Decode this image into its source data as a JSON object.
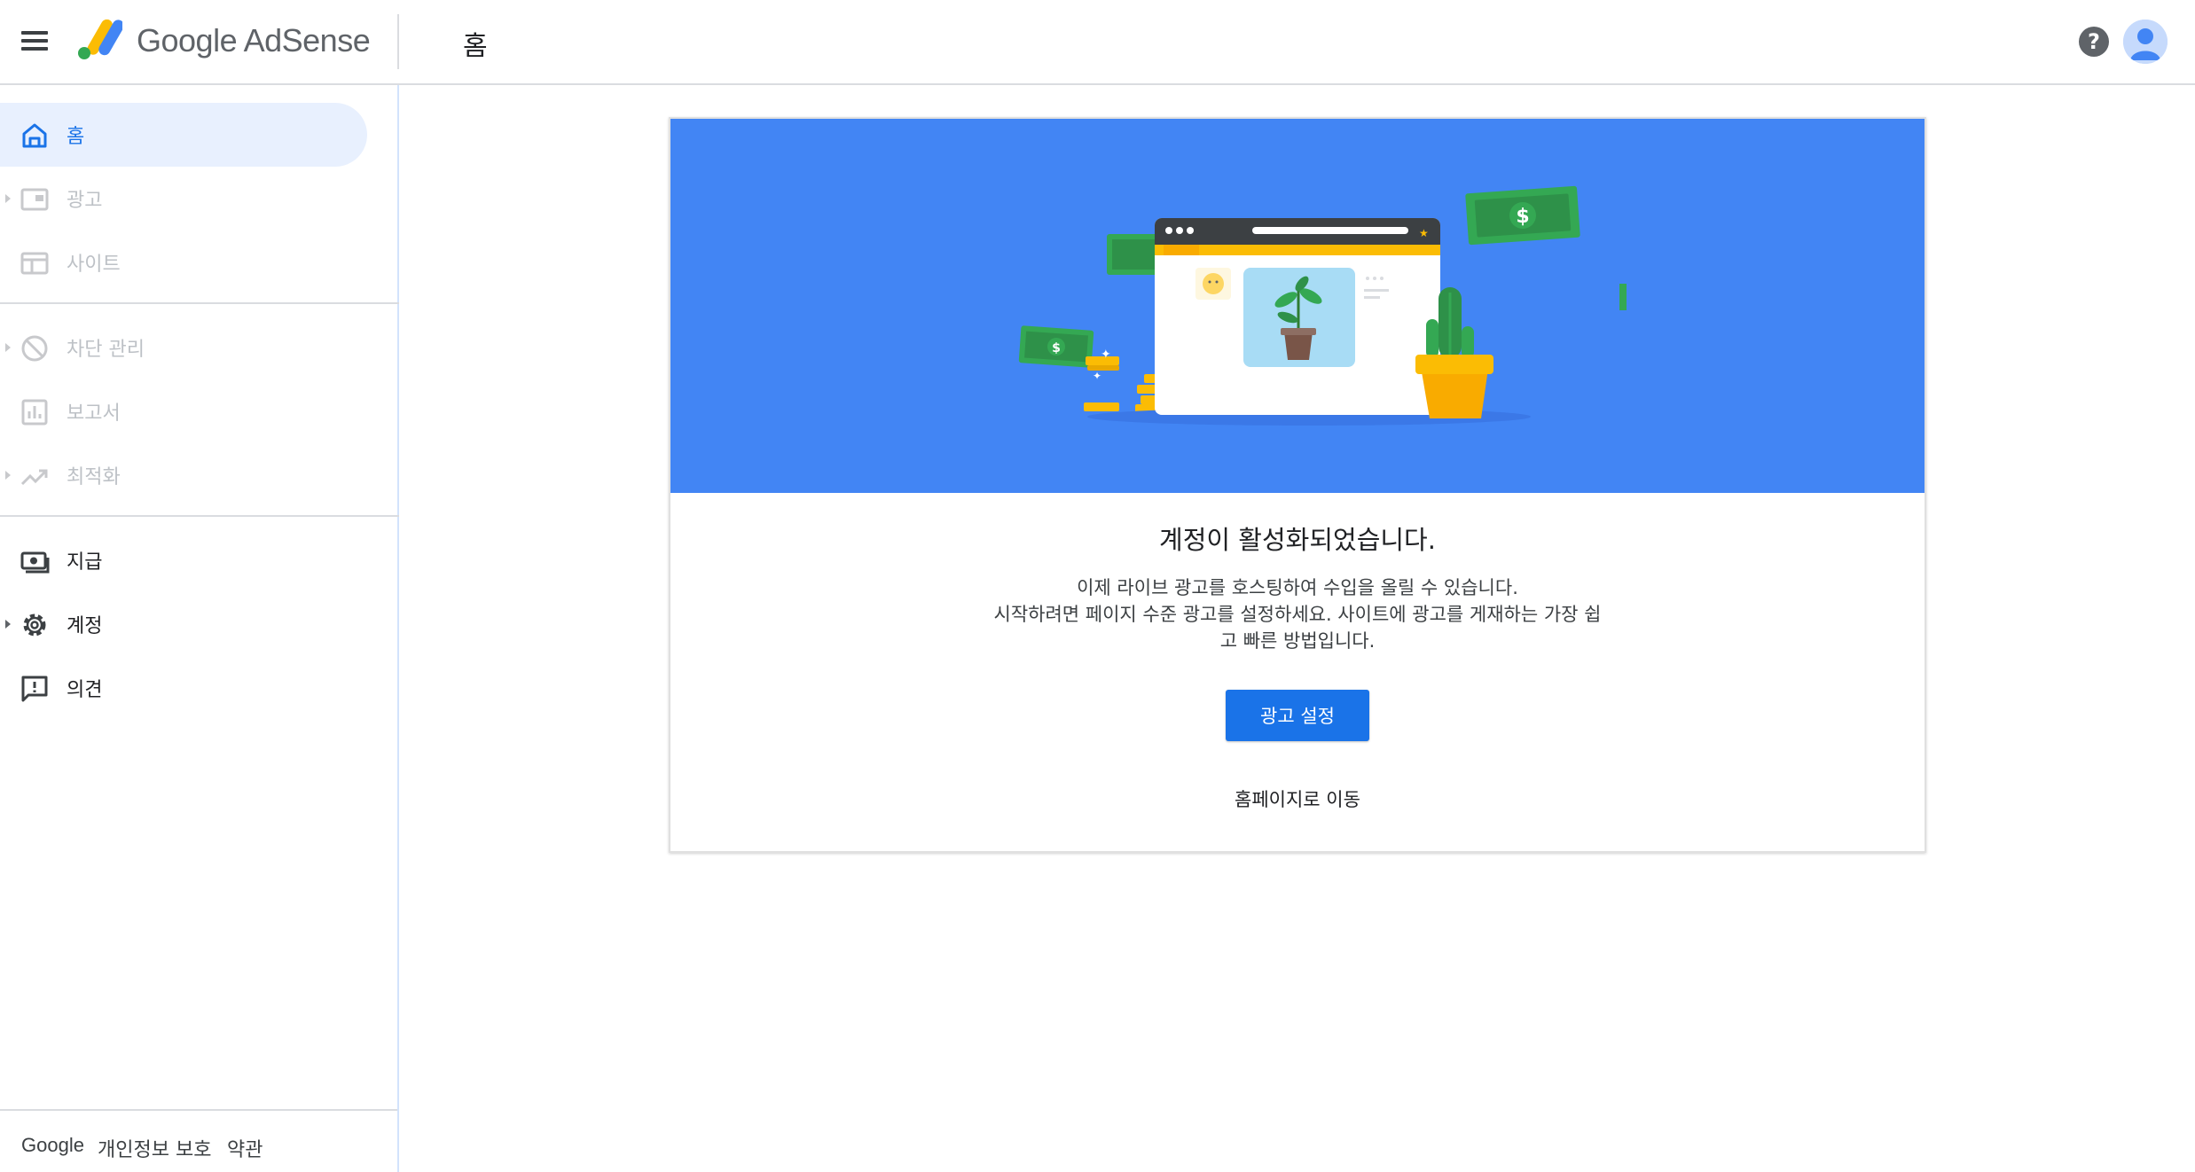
{
  "header": {
    "brand": "Google AdSense",
    "page_title": "홈",
    "help_glyph": "?"
  },
  "sidebar": {
    "items": [
      {
        "label": "홈",
        "icon": "home-icon",
        "state": "active",
        "expandable": false
      },
      {
        "label": "광고",
        "icon": "ads-icon",
        "state": "disabled",
        "expandable": true
      },
      {
        "label": "사이트",
        "icon": "sites-icon",
        "state": "disabled",
        "expandable": false
      },
      {
        "label": "차단 관리",
        "icon": "block-icon",
        "state": "disabled",
        "expandable": true
      },
      {
        "label": "보고서",
        "icon": "reports-icon",
        "state": "disabled",
        "expandable": false
      },
      {
        "label": "최적화",
        "icon": "optimization-icon",
        "state": "disabled",
        "expandable": true
      },
      {
        "label": "지급",
        "icon": "payments-icon",
        "state": "normal",
        "expandable": false
      },
      {
        "label": "계정",
        "icon": "gear-icon",
        "state": "normal",
        "expandable": true
      },
      {
        "label": "의견",
        "icon": "feedback-icon",
        "state": "normal",
        "expandable": false
      }
    ],
    "footer": {
      "google": "Google",
      "privacy": "개인정보 보호",
      "terms": "약관"
    }
  },
  "card": {
    "title": "계정이 활성화되었습니다.",
    "description_line1": "이제 라이브 광고를 호스팅하여 수입을 올릴 수 있습니다.",
    "description_line2": "시작하려면 페이지 수준 광고를 설정하세요. 사이트에 광고를 게재하는 가장 쉽",
    "description_line3": "고 빠른 방법입니다.",
    "setup_button": "광고 설정",
    "home_link": "홈페이지로 이동",
    "dollar_sign": "$"
  },
  "colors": {
    "accent": "#1a73e8",
    "hero_bg": "#4285f4",
    "active_nav_bg": "#e8f0fe",
    "money_green": "#34a853",
    "coin_yellow": "#fbbc04"
  }
}
